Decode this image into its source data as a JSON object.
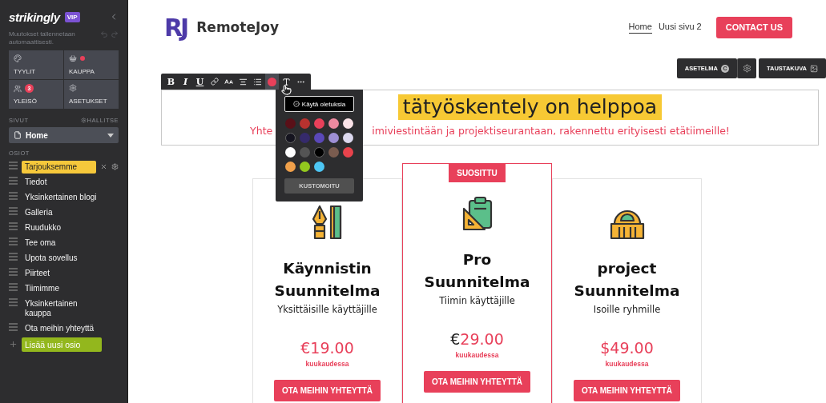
{
  "sidebar": {
    "logo": "strikingly",
    "plan_badge": "VIP",
    "autosave_note": "Muutokset tallennetaan automaattisesti.",
    "tiles": [
      {
        "label": "TYYLIT",
        "notification_dot": false
      },
      {
        "label": "KAUPPA",
        "notification_dot": true
      },
      {
        "label": "YLEISÖ",
        "notification_dot": false,
        "badge": "3"
      },
      {
        "label": "ASETUKSET",
        "notification_dot": false
      }
    ],
    "pages_heading": "SIVUT",
    "manage_link": "HALLITSE",
    "page_select": {
      "value": "Home"
    },
    "sections_heading": "OSIOT",
    "sections": [
      {
        "label": "Tarjouksemme",
        "selected": true
      },
      {
        "label": "Tiedot",
        "selected": false
      },
      {
        "label": "Yksinkertainen blogi",
        "selected": false
      },
      {
        "label": "Galleria",
        "selected": false
      },
      {
        "label": "Ruudukko",
        "selected": false
      },
      {
        "label": "Tee oma",
        "selected": false
      },
      {
        "label": "Upota sovellus",
        "selected": false
      },
      {
        "label": "Piirteet",
        "selected": false
      },
      {
        "label": "Tiimimme",
        "selected": false
      },
      {
        "label": "Yksinkertainen kauppa",
        "selected": false
      },
      {
        "label": "Ota meihin yhteyttä",
        "selected": false
      }
    ],
    "add_section_button": "Lisää uusi osio"
  },
  "site_header": {
    "logo_mark": "RJ",
    "brand": "RemoteJoy",
    "nav": [
      {
        "label": "Home",
        "selected": true
      },
      {
        "label": "Uusi sivu 2",
        "selected": false
      }
    ],
    "cta_button": "CONTACT US"
  },
  "section_controls": {
    "layout_button": "ASETELMA",
    "layout_badge": "C",
    "background_button": "TAUSTAKUVA"
  },
  "text_toolbar": {
    "format_buttons": [
      "B",
      "I",
      "U"
    ],
    "color_button": {
      "color": "#e8405a",
      "selected": true
    }
  },
  "color_picker": {
    "default_button": "Käytä oletuksia",
    "swatches": [
      {
        "color": "#5a1018"
      },
      {
        "color": "#b8322f"
      },
      {
        "color": "#e8405a"
      },
      {
        "color": "#ee8aa0"
      },
      {
        "color": "#fbe3e8"
      },
      {
        "color": "#15141f"
      },
      {
        "color": "#352a6b"
      },
      {
        "color": "#5a48b8"
      },
      {
        "color": "#9e8fd4"
      },
      {
        "color": "#dcd8ee"
      },
      {
        "color": "#ffffff"
      },
      {
        "color": "#545454"
      },
      {
        "color": "#000000"
      },
      {
        "color": "#7a5c4f"
      },
      {
        "color": "#e8434c"
      },
      {
        "color": "#f0a04a"
      },
      {
        "color": "#93c91e"
      },
      {
        "color": "#4dc6f4"
      }
    ],
    "custom_button": "KUSTOMOITU"
  },
  "hero": {
    "headline_visible": "tätyöskentely on helppoa",
    "subtitle_left": "Yhte",
    "subtitle_right": "imiviestintään ja projektiseurantaan, rakennettu erityisesti etätiimeille!"
  },
  "pricing": [
    {
      "title": "Käynnistin Suunnitelma",
      "subtitle": "Yksittäisille käyttäjille",
      "currency": "€",
      "amount": "19.00",
      "period": "kuukaudessa",
      "button": "OTA MEIHIN YHTEYTTÄ",
      "featured": false
    },
    {
      "ribbon": "SUOSITTU",
      "title": "Pro Suunnitelma",
      "subtitle": "Tiimin käyttäjille",
      "currency": "€",
      "amount": "29.00",
      "period": "kuukaudessa",
      "button": "OTA MEIHIN YHTEYTTÄ",
      "featured": true
    },
    {
      "title": "project Suunnitelma",
      "subtitle": "Isoille ryhmille",
      "currency": "$",
      "amount": "49.00",
      "period": "kuukaudessa",
      "button": "OTA MEIHIN YHTEYTTÄ",
      "featured": false
    }
  ]
}
